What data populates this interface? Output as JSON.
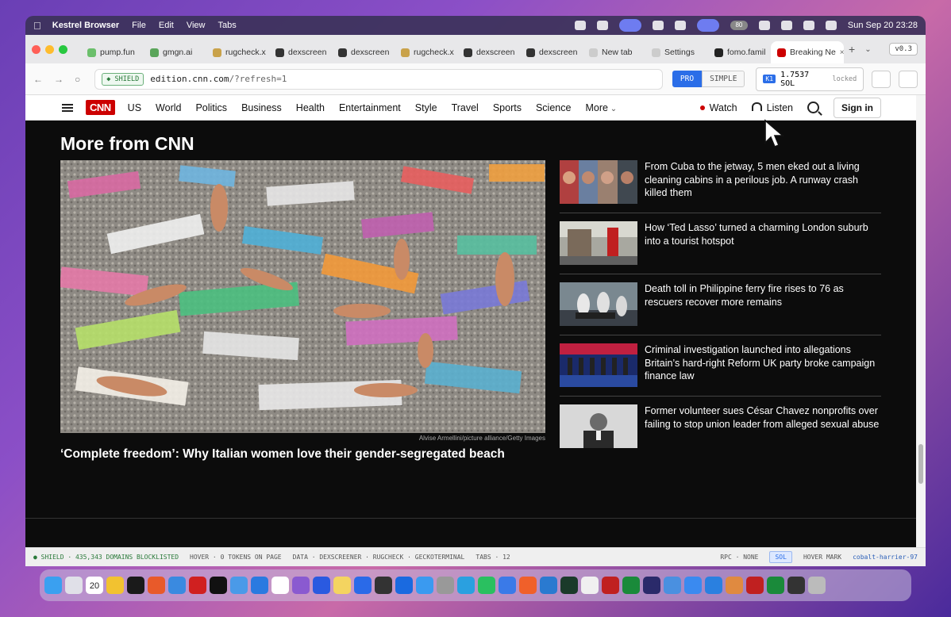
{
  "menubar": {
    "app_name": "Kestrel Browser",
    "menus": [
      "File",
      "Edit",
      "View",
      "Tabs"
    ],
    "clock": "Sun Sep 20  23:28",
    "battery_badge": "80"
  },
  "tabs": [
    {
      "title": "pump.fun",
      "color": "#6bbf6b"
    },
    {
      "title": "gmgn.ai",
      "color": "#5aa55a"
    },
    {
      "title": "rugcheck.x",
      "color": "#c9a24a"
    },
    {
      "title": "dexscreen",
      "color": "#333333"
    },
    {
      "title": "dexscreen",
      "color": "#333333"
    },
    {
      "title": "rugcheck.x",
      "color": "#c9a24a"
    },
    {
      "title": "dexscreen",
      "color": "#333333"
    },
    {
      "title": "dexscreen",
      "color": "#333333"
    },
    {
      "title": "New tab",
      "color": "#cccccc"
    },
    {
      "title": "Settings",
      "color": "#cccccc"
    },
    {
      "title": "fomo.famil",
      "color": "#222222"
    },
    {
      "title": "Breaking Ne",
      "color": "#cc0000"
    }
  ],
  "version": "v0.3",
  "toolbar": {
    "shield": "SHIELD",
    "url_host": "edition.cnn.com",
    "url_path": "/?refresh=1",
    "mode_pro": "PRO",
    "mode_simple": "SIMPLE",
    "wallet_key": "K1",
    "wallet_balance": "1.7537 SOL",
    "wallet_state": "locked"
  },
  "cnn_nav": {
    "logo": "CNN",
    "links": [
      "US",
      "World",
      "Politics",
      "Business",
      "Health",
      "Entertainment",
      "Style",
      "Travel",
      "Sports",
      "Science",
      "More"
    ],
    "watch": "Watch",
    "listen": "Listen",
    "signin": "Sign in"
  },
  "section": {
    "title": "More from CNN",
    "hero_credit": "Alvise Armellini/picture alliance/Getty Images",
    "hero_headline": "‘Complete freedom’: Why Italian women love their gender-segregated beach",
    "stories": [
      "From Cuba to the jetway, 5 men eked out a living cleaning cabins in a perilous job. A runway crash killed them",
      "How ‘Ted Lasso’ turned a charming London suburb into a tourist hotspot",
      "Death toll in Philippine ferry fire rises to 76 as rescuers recover more remains",
      "Criminal investigation launched into allegations Britain’s hard-right Reform UK party broke campaign finance law",
      "Former volunteer sues César Chavez nonprofits over failing to stop union leader from alleged sexual abuse"
    ]
  },
  "statusbar": {
    "shield": "● SHIELD · 435,343 DOMAINS BLOCKLISTED",
    "hover": "HOVER · 0 TOKENS ON PAGE",
    "data": "DATA · DEXSCREENER · RUGCHECK · GECKOTERMINAL",
    "tabs": "TABS · 12",
    "rpc": "RPC · NONE",
    "sol": "SOL",
    "hover_mark": "HOVER MARK",
    "wallet_name": "cobalt-harrier-97"
  },
  "dock_date": "20"
}
